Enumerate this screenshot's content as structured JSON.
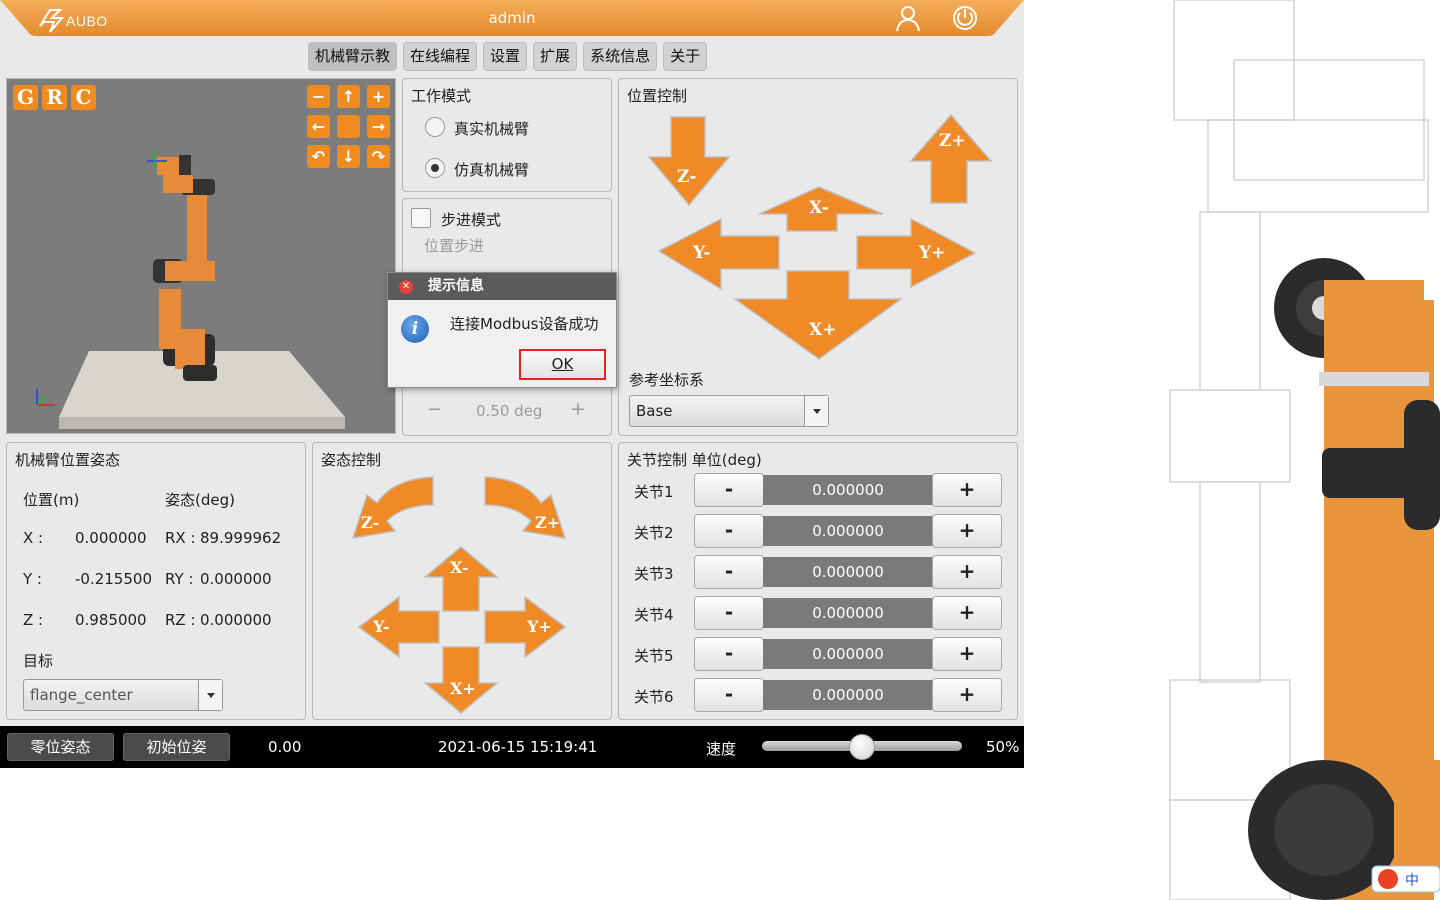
{
  "header": {
    "logo_text": "AUBO",
    "title": "admin",
    "user_icon": "user-icon",
    "power_icon": "power-icon"
  },
  "tabs": [
    {
      "label": "机械臂示教",
      "active": true
    },
    {
      "label": "在线编程"
    },
    {
      "label": "设置"
    },
    {
      "label": "扩展"
    },
    {
      "label": "系统信息"
    },
    {
      "label": "关于"
    }
  ],
  "viewer": {
    "buttons": [
      "G",
      "R",
      "C"
    ]
  },
  "work_mode": {
    "title": "工作模式",
    "options": [
      {
        "label": "真实机械臂",
        "selected": false
      },
      {
        "label": "仿真机械臂",
        "selected": true
      }
    ]
  },
  "step_mode": {
    "label": "步进模式",
    "position_step_label": "位置步进",
    "checked": false,
    "orient_step_value": "0.50 deg",
    "minus": "−",
    "plus": "+"
  },
  "position_control": {
    "title": "位置控制",
    "arrows": {
      "z_minus": "Z-",
      "z_plus": "Z+",
      "x_minus": "X-",
      "x_plus": "X+",
      "y_minus": "Y-",
      "y_plus": "Y+"
    },
    "ref_frame_label": "参考坐标系",
    "ref_frame_value": "Base"
  },
  "pose": {
    "title": "机械臂位置姿态",
    "pos_header": "位置(m)",
    "ori_header": "姿态(deg)",
    "rows": [
      {
        "axis": "X :",
        "value": "0.000000",
        "rot": "RX :",
        "rot_value": "89.999962"
      },
      {
        "axis": "Y :",
        "value": "-0.215500",
        "rot": "RY :",
        "rot_value": "0.000000"
      },
      {
        "axis": "Z :",
        "value": "0.985000",
        "rot": "RZ :",
        "rot_value": "0.000000"
      }
    ],
    "target_label": "目标",
    "target_value": "flange_center"
  },
  "attitude_control": {
    "title": "姿态控制",
    "arrows": {
      "z_minus": "Z-",
      "z_plus": "Z+",
      "x_minus": "X-",
      "x_plus": "X+",
      "y_minus": "Y-",
      "y_plus": "Y+"
    }
  },
  "joint_control": {
    "title": "关节控制 单位(deg)",
    "minus": "-",
    "plus": "+",
    "joints": [
      {
        "label": "关节1",
        "value": "0.000000"
      },
      {
        "label": "关节2",
        "value": "0.000000"
      },
      {
        "label": "关节3",
        "value": "0.000000"
      },
      {
        "label": "关节4",
        "value": "0.000000"
      },
      {
        "label": "关节5",
        "value": "0.000000"
      },
      {
        "label": "关节6",
        "value": "0.000000"
      }
    ]
  },
  "status_bar": {
    "zero_pose": "零位姿态",
    "init_pose": "初始位姿",
    "value": "0.00",
    "datetime": "2021-06-15 15:19:41",
    "speed_label": "速度",
    "speed_percent": "50%",
    "speed_fraction": 0.5
  },
  "dialog": {
    "title": "提示信息",
    "message": "连接Modbus设备成功",
    "ok": "OK"
  },
  "colors": {
    "accent": "#f08b1f",
    "header": "#f0a04a",
    "arrow": "#ef8a26"
  },
  "ime": {
    "text": "中"
  }
}
